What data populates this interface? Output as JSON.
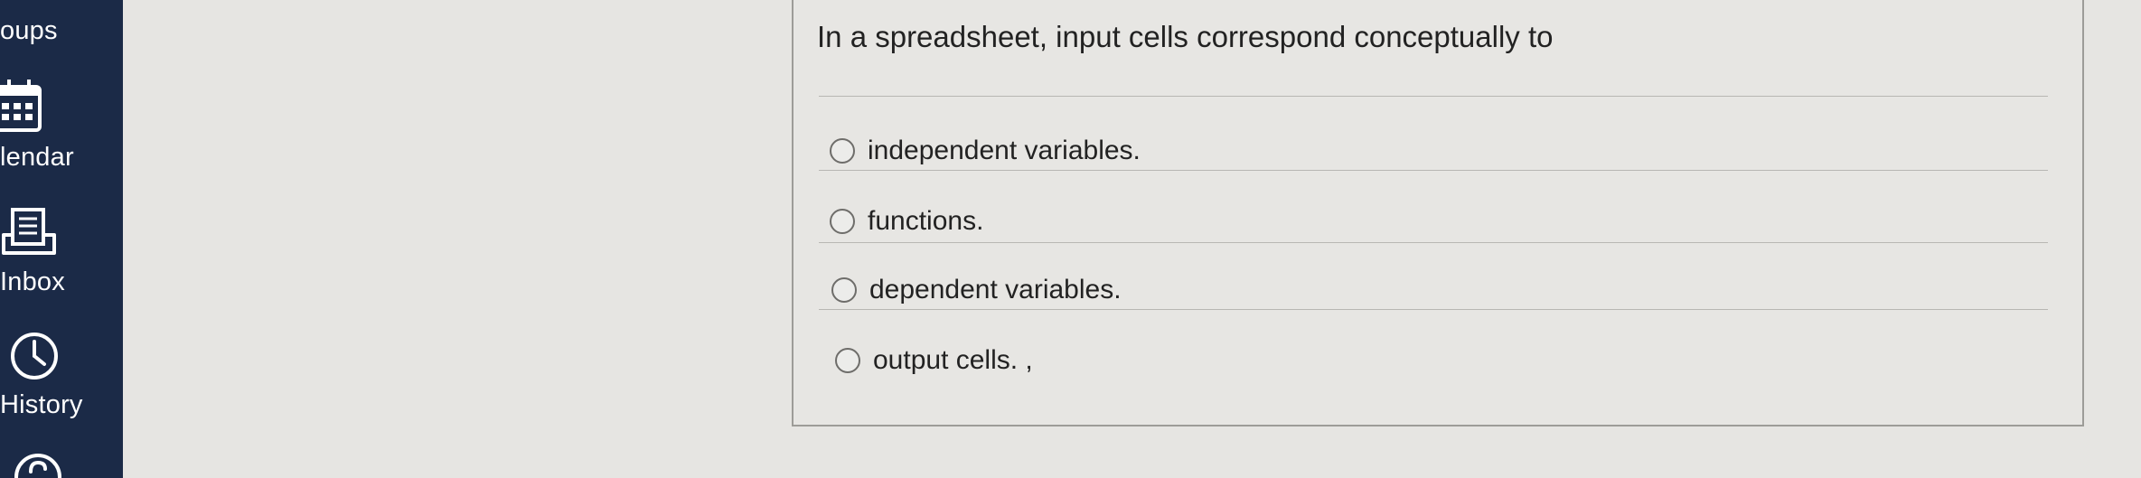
{
  "sidebar": {
    "items": [
      {
        "label": "oups",
        "icon": "groups-icon"
      },
      {
        "label": "lendar",
        "icon": "calendar-icon"
      },
      {
        "label": "Inbox",
        "icon": "inbox-icon"
      },
      {
        "label": "History",
        "icon": "clock-icon"
      },
      {
        "label": "",
        "icon": "help-icon"
      }
    ],
    "background_color": "#1b2a47"
  },
  "question": {
    "text": "In a spreadsheet, input cells correspond conceptually to",
    "answers": [
      {
        "label": "independent variables."
      },
      {
        "label": "functions."
      },
      {
        "label": "dependent variables."
      },
      {
        "label": "output cells. ,"
      }
    ]
  }
}
